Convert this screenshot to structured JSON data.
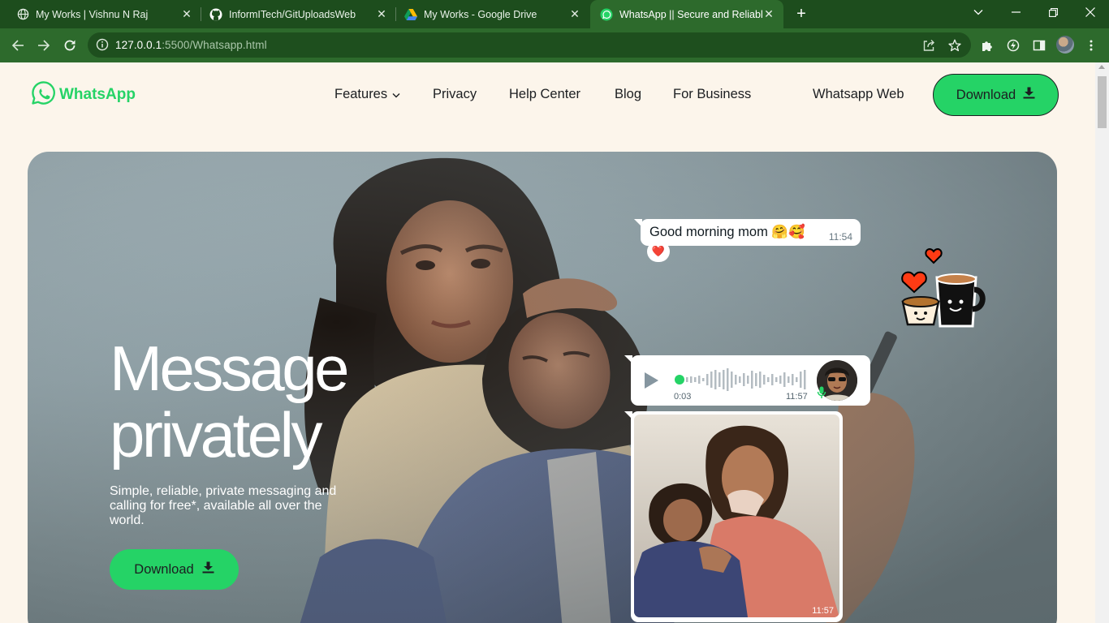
{
  "browser": {
    "tabs": [
      {
        "title": "My Works | Vishnu N Raj",
        "icon": "globe-icon",
        "active": false
      },
      {
        "title": "InformITech/GitUploadsWeb",
        "icon": "github-icon",
        "active": false
      },
      {
        "title": "My Works - Google Drive",
        "icon": "google-drive-icon",
        "active": false
      },
      {
        "title": "WhatsApp || Secure and Reliable",
        "icon": "whatsapp-icon",
        "active": true
      }
    ],
    "url_host": "127.0.0.1",
    "url_rest": ":5500/Whatsapp.html",
    "colors": {
      "frame": "#1d4d1d",
      "toolbar": "#2d6a2c",
      "omnibox": "#1e4f1e"
    }
  },
  "site": {
    "logo_text": "WhatsApp",
    "nav": {
      "features": "Features",
      "privacy": "Privacy",
      "help_center": "Help Center",
      "blog": "Blog",
      "for_business": "For Business",
      "whatsapp_web": "Whatsapp Web",
      "download": "Download"
    },
    "colors": {
      "brand": "#25d366",
      "background": "#fcf5eb",
      "text": "#1c1e21"
    }
  },
  "hero": {
    "headline_line1": "Message",
    "headline_line2": "privately",
    "subtext": "Simple, reliable, private messaging and calling for free*, available all over the world.",
    "download": "Download",
    "chat": {
      "message": "Good morning mom 🤗🥰",
      "message_time": "11:54",
      "reaction": "❤️",
      "voice_duration": "0:03",
      "voice_time": "11:57",
      "photo_time": "11:57"
    }
  }
}
